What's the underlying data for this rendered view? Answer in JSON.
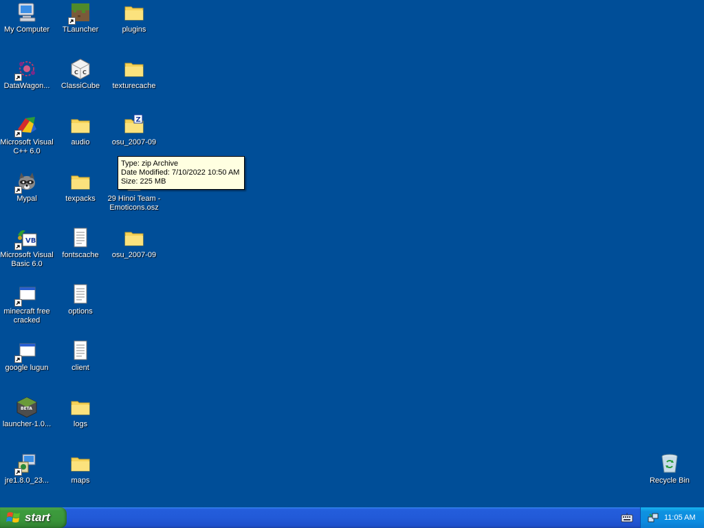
{
  "desktop": {
    "icons": [
      {
        "label": "My Computer",
        "type": "computer"
      },
      {
        "label": "DataWagon...",
        "type": "datawagon"
      },
      {
        "label": "Microsoft Visual C++ 6.0",
        "type": "vcpp"
      },
      {
        "label": "Mypal",
        "type": "mypal"
      },
      {
        "label": "Microsoft Visual Basic 6.0",
        "type": "vb"
      },
      {
        "label": "minecraft free cracked",
        "type": "generic-shortcut"
      },
      {
        "label": "google lugun",
        "type": "generic-shortcut"
      },
      {
        "label": "launcher-1.0...",
        "type": "betacraft"
      },
      {
        "label": "jre1.8.0_23...",
        "type": "installer"
      },
      {
        "label": "TLauncher",
        "type": "tlauncher"
      },
      {
        "label": "ClassiCube",
        "type": "classicube"
      },
      {
        "label": "audio",
        "type": "folder"
      },
      {
        "label": "texpacks",
        "type": "folder"
      },
      {
        "label": "fontscache",
        "type": "document"
      },
      {
        "label": "options",
        "type": "document"
      },
      {
        "label": "client",
        "type": "document"
      },
      {
        "label": "logs",
        "type": "folder"
      },
      {
        "label": "maps",
        "type": "folder"
      },
      {
        "label": "plugins",
        "type": "folder"
      },
      {
        "label": "texturecache",
        "type": "folder"
      },
      {
        "label": "osu_2007-09",
        "type": "zip-folder"
      },
      {
        "label": "29 Hinoi Team - Emoticons.osz",
        "type": "osz-file"
      },
      {
        "label": "osu_2007-09",
        "type": "folder"
      }
    ],
    "recycle_bin": {
      "label": "Recycle Bin"
    }
  },
  "tooltip": {
    "type_line": "Type: zip Archive",
    "modified_line": "Date Modified: 7/10/2022 10:50 AM",
    "size_line": "Size: 225 MB"
  },
  "taskbar": {
    "start_label": "start",
    "clock": "11:05 AM",
    "tray_icons": [
      "keyboard-icon",
      "network-icon"
    ]
  },
  "colors": {
    "desktop_bg": "#004e98",
    "taskbar": "#245edc",
    "start_button": "#3d9b3d",
    "tray": "#0f92e0",
    "tooltip_bg": "#ffffe1"
  }
}
